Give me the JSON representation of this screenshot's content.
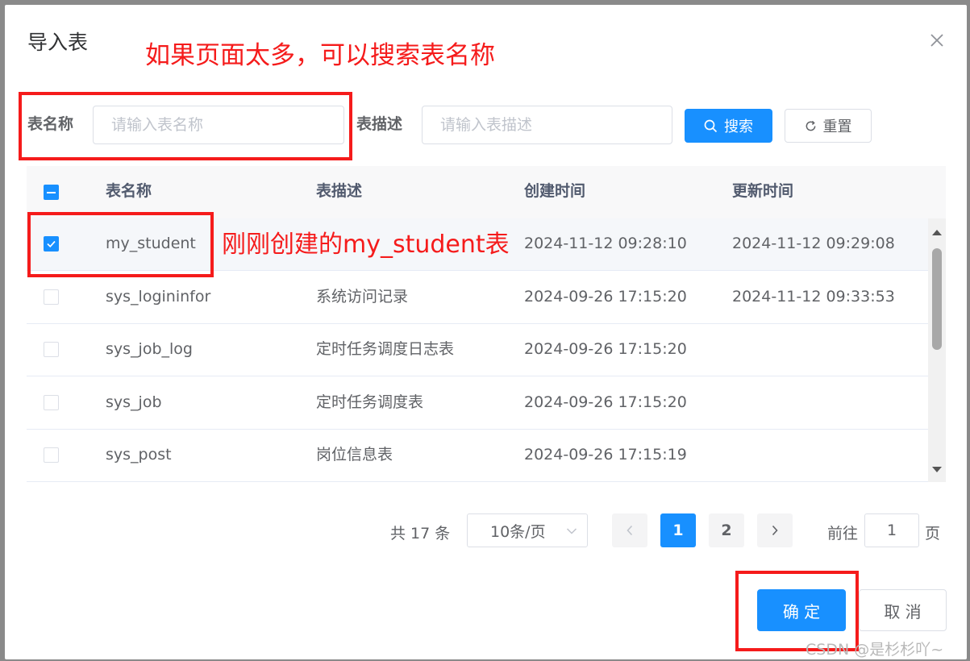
{
  "dialog": {
    "title": "导入表"
  },
  "annotations": {
    "search_hint": "如果页面太多，可以搜索表名称",
    "row_hint": "刚刚创建的my_student表"
  },
  "filters": {
    "name_label": "表名称",
    "name_placeholder": "请输入表名称",
    "desc_label": "表描述",
    "desc_placeholder": "请输入表描述",
    "search_label": "搜索",
    "reset_label": "重置"
  },
  "table": {
    "headers": [
      "表名称",
      "表描述",
      "创建时间",
      "更新时间"
    ],
    "rows": [
      {
        "name": "my_student",
        "desc": "",
        "created": "2024-11-12 09:28:10",
        "updated": "2024-11-12 09:29:08",
        "checked": true
      },
      {
        "name": "sys_logininfor",
        "desc": "系统访问记录",
        "created": "2024-09-26 17:15:20",
        "updated": "2024-11-12 09:33:53",
        "checked": false
      },
      {
        "name": "sys_job_log",
        "desc": "定时任务调度日志表",
        "created": "2024-09-26 17:15:20",
        "updated": "",
        "checked": false
      },
      {
        "name": "sys_job",
        "desc": "定时任务调度表",
        "created": "2024-09-26 17:15:20",
        "updated": "",
        "checked": false
      },
      {
        "name": "sys_post",
        "desc": "岗位信息表",
        "created": "2024-09-26 17:15:19",
        "updated": "",
        "checked": false
      }
    ]
  },
  "pagination": {
    "total": "共 17 条",
    "page_size": "10条/页",
    "pages": [
      "1",
      "2"
    ],
    "current": "1",
    "goto_label": "前往",
    "goto_value": "1",
    "page_suffix": "页"
  },
  "footer": {
    "confirm_label": "确 定",
    "cancel_label": "取 消"
  },
  "watermark": "CSDN @是杉杉吖~",
  "colors": {
    "primary": "#1890ff",
    "annotation": "#f51b1b"
  }
}
